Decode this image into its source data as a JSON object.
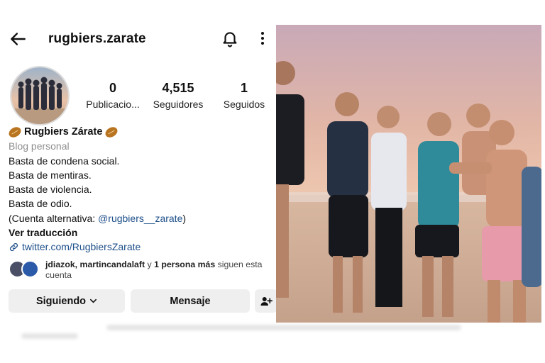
{
  "profile": {
    "username": "rugbiers.zarate",
    "stats": [
      {
        "value": "0",
        "label": "Publicacio..."
      },
      {
        "value": "4,515",
        "label": "Seguidores"
      },
      {
        "value": "1",
        "label": "Seguidos"
      }
    ],
    "name": "Rugbiers Zárate",
    "category": "Blog personal",
    "bio_lines": [
      "Basta de condena social.",
      "Basta de mentiras.",
      "Basta de violencia.",
      "Basta de odio."
    ],
    "alt_account_prefix": "(Cuenta alternativa: ",
    "alt_account_mention": "@rugbiers__zarate",
    "alt_account_suffix": ")",
    "translate_label": "Ver traducción",
    "link": "twitter.com/RugbiersZarate",
    "followed_by": {
      "names": "jdiazok, martincandalaft",
      "connector": " y ",
      "others": "1 persona más",
      "suffix": " siguen esta cuenta"
    },
    "buttons": {
      "following": "Siguiendo",
      "message": "Mensaje"
    }
  },
  "icons": {
    "back": "arrow-left-icon",
    "notifications": "bell-icon",
    "more": "more-vertical-icon",
    "link": "link-icon",
    "add_user": "add-user-icon",
    "chevron": "chevron-down-icon"
  },
  "colors": {
    "link_blue": "#1e4f8a",
    "button_bg": "#efefef",
    "muted_text": "#8e8e8e"
  }
}
